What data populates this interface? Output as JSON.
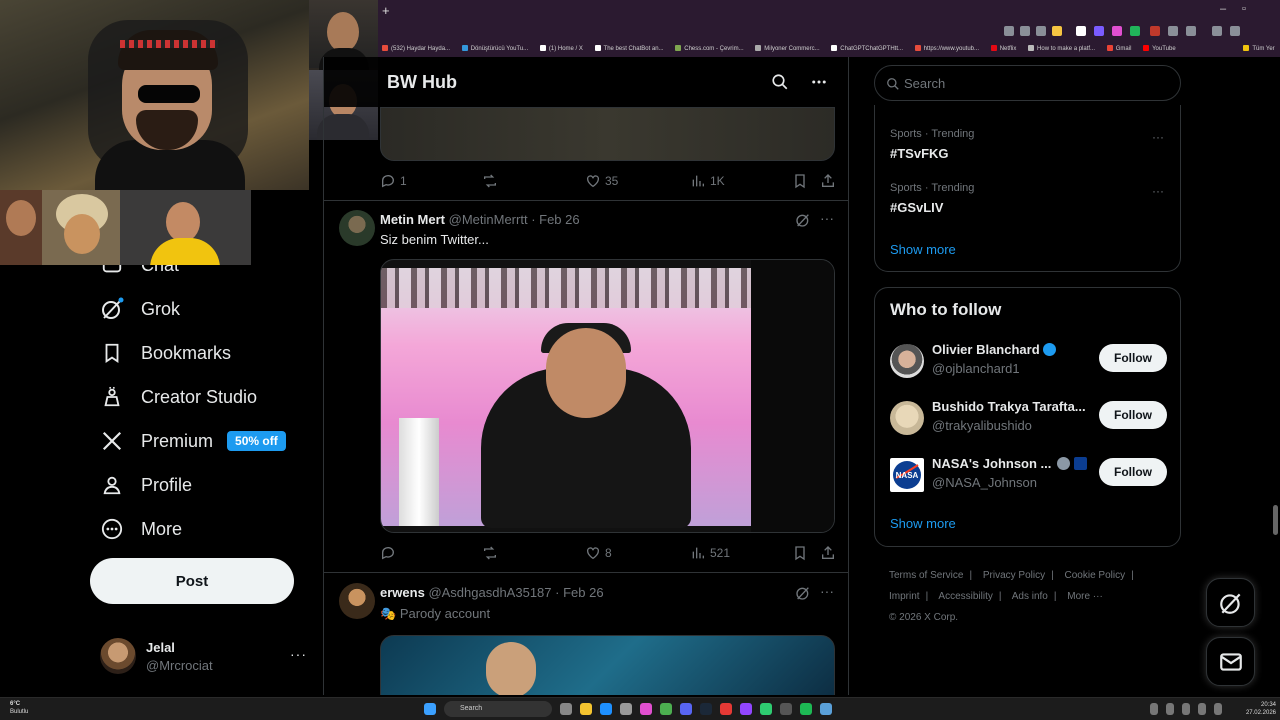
{
  "browser": {
    "bookmarks": [
      "(532) Haydar Hayda...",
      "Dönüştürücü YouTu...",
      "(1) Home / X",
      "The best ChatBot an...",
      "Chess.com - Çevrim...",
      "Milyoner Commerc...",
      "ChatGPTChatGPTHtt...",
      "https://www.youtub...",
      "Netflix",
      "How to make a platf...",
      "Gmail",
      "YouTube",
      "Tüm Yer"
    ]
  },
  "sidebar": {
    "items": [
      {
        "label": "Chat"
      },
      {
        "label": "Grok"
      },
      {
        "label": "Bookmarks"
      },
      {
        "label": "Creator Studio"
      },
      {
        "label": "Premium",
        "badge": "50% off"
      },
      {
        "label": "Profile"
      },
      {
        "label": "More"
      }
    ],
    "post_label": "Post",
    "account": {
      "name": "Jelal",
      "handle": "@Mrcrociat",
      "more": "···"
    }
  },
  "main": {
    "title": "BW Hub",
    "tweet0_actions": {
      "replies": "1",
      "retweets": "",
      "likes": "35",
      "views": "1K"
    },
    "tweets": [
      {
        "name": "Metin Mert",
        "handle": "@MetinMerrtt",
        "date": "· Feb 26",
        "text": "Siz benim Twitter...",
        "actions": {
          "replies": "",
          "retweets": "",
          "likes": "8",
          "views": "521"
        }
      },
      {
        "name": "erwens",
        "handle": "@AsdhgasdhA35187",
        "date": "· Feb 26",
        "label": "Parody account"
      }
    ]
  },
  "right": {
    "search_placeholder": "Search",
    "trends": [
      {
        "category": "Sports · Trending",
        "tag": "#TSvFKG"
      },
      {
        "category": "Sports · Trending",
        "tag": "#GSvLIV"
      }
    ],
    "show_more": "Show more",
    "who_to_follow": {
      "title": "Who to follow",
      "follow_label": "Follow",
      "accounts": [
        {
          "name": "Olivier Blanchard",
          "handle": "@ojblanchard1"
        },
        {
          "name": "Bushido Trakya Tarafta...",
          "handle": "@trakyalibushido"
        },
        {
          "name": "NASA's Johnson ...",
          "handle": "@NASA_Johnson"
        }
      ],
      "show_more": "Show more"
    },
    "footer": {
      "links": [
        "Terms of Service",
        "Privacy Policy",
        "Cookie Policy",
        "Imprint",
        "Accessibility",
        "Ads info",
        "More ···"
      ],
      "copyright": "© 2026 X Corp."
    }
  },
  "taskbar": {
    "weather_temp": "6°C",
    "weather_desc": "Bulutlu",
    "search": "Search",
    "time": "20:34",
    "date": "27.02.2026"
  },
  "colors": {
    "accent": "#1d9bf0",
    "bg": "#000000",
    "border": "#2f3336",
    "muted": "#71767b"
  }
}
